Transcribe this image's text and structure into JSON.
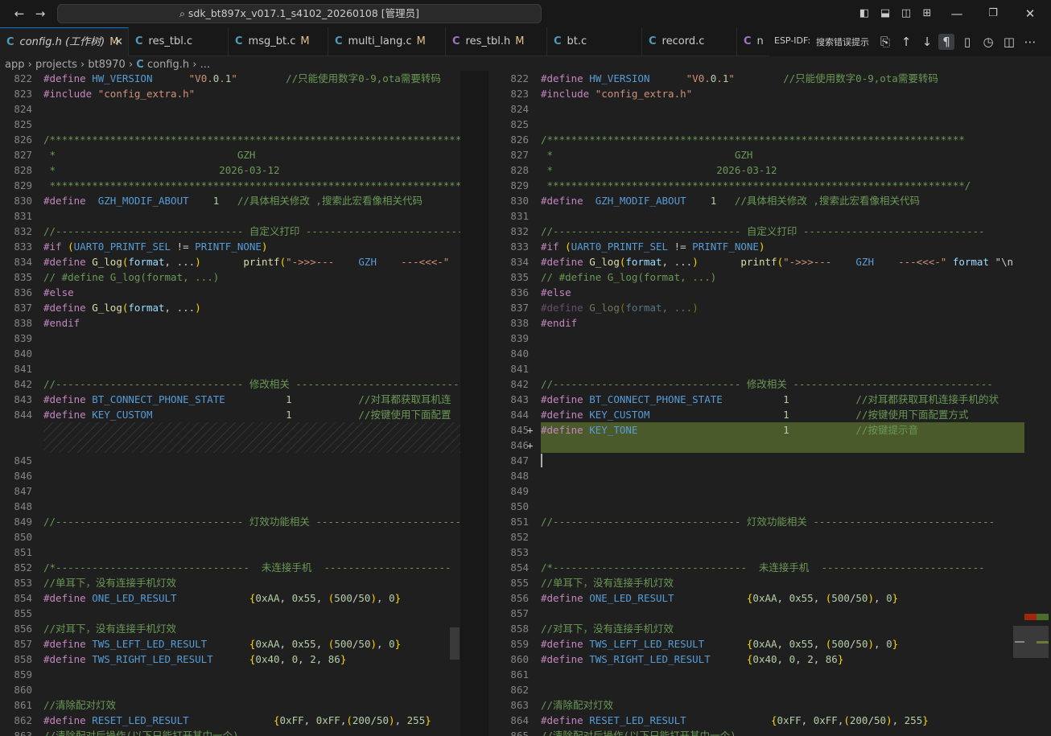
{
  "titlebar": {
    "title": "sdk_bt897x_v017.1_s4102_20260108 [管理员]",
    "back": "←",
    "forward": "→",
    "min": "—",
    "max": "❐",
    "close": "✕"
  },
  "tabs": [
    {
      "label": "config.h (工作树)",
      "mod": "M",
      "icon": "C",
      "active": true
    },
    {
      "label": "res_tbl.c",
      "mod": "",
      "icon": "C"
    },
    {
      "label": "msg_bt.c",
      "mod": "M",
      "icon": "C"
    },
    {
      "label": "multi_lang.c",
      "mod": "M",
      "icon": "C"
    },
    {
      "label": "res_tbl.h",
      "mod": "M",
      "icon": "C"
    },
    {
      "label": "bt.c",
      "mod": "",
      "icon": "C"
    },
    {
      "label": "record.c",
      "mod": "",
      "icon": "C"
    },
    {
      "label": "n",
      "mod": "",
      "icon": "C"
    }
  ],
  "tabtools": {
    "esp": "ESP-IDF:",
    "search": "搜索错误提示"
  },
  "breadcrumb": {
    "app": "app",
    "projects": "projects",
    "bt8970": "bt8970",
    "file": "config.h",
    "more": "..."
  },
  "left": {
    "lines": [
      {
        "n": "822",
        "t": "#define HW_VERSION      \"V0.0.1\"        //只能使用数字0-9,ota需要转码"
      },
      {
        "n": "823",
        "t": "#include \"config_extra.h\""
      },
      {
        "n": "824",
        "t": ""
      },
      {
        "n": "825",
        "t": ""
      },
      {
        "n": "826",
        "t": "/*********************************************************************"
      },
      {
        "n": "827",
        "t": " *                              GZH"
      },
      {
        "n": "828",
        "t": " *                           2026-03-12"
      },
      {
        "n": "829",
        "t": " *********************************************************************"
      },
      {
        "n": "830",
        "t": "#define  GZH_MODIF_ABOUT    1   //具体相关修改 ,搜索此宏看像相关代码"
      },
      {
        "n": "831",
        "t": ""
      },
      {
        "n": "832",
        "t": "//------------------------------- 自定义打印 --------------------------"
      },
      {
        "n": "833",
        "t": "#if (UART0_PRINTF_SEL != PRINTF_NONE)"
      },
      {
        "n": "834",
        "t": "#define G_log(format, ...)       printf(\"->>>---    GZH    ---<<<-\""
      },
      {
        "n": "835",
        "t": "// #define G_log(format, ...)"
      },
      {
        "n": "836",
        "t": "#else"
      },
      {
        "n": "837",
        "t": "#define G_log(format, ...)"
      },
      {
        "n": "838",
        "t": "#endif"
      },
      {
        "n": "839",
        "t": ""
      },
      {
        "n": "840",
        "t": ""
      },
      {
        "n": "841",
        "t": ""
      },
      {
        "n": "842",
        "t": "//------------------------------- 修改相关 ----------------------------"
      },
      {
        "n": "843",
        "t": "#define BT_CONNECT_PHONE_STATE          1           //对耳都获取耳机连"
      },
      {
        "n": "844",
        "t": "#define KEY_CUSTOM                      1           //按键使用下面配置"
      }
    ],
    "lines2": [
      {
        "n": "845",
        "t": ""
      },
      {
        "n": "846",
        "t": ""
      },
      {
        "n": "847",
        "t": ""
      },
      {
        "n": "848",
        "t": ""
      },
      {
        "n": "849",
        "t": "//------------------------------- 灯效功能相关 ------------------------"
      },
      {
        "n": "850",
        "t": ""
      },
      {
        "n": "851",
        "t": ""
      },
      {
        "n": "852",
        "t": "/*--------------------------------  未连接手机  ---------------------"
      },
      {
        "n": "853",
        "t": "//单耳下，没有连接手机灯效"
      },
      {
        "n": "854",
        "t": "#define ONE_LED_RESULT            {0xAA, 0x55, (500/50), 0}"
      },
      {
        "n": "855",
        "t": ""
      },
      {
        "n": "856",
        "t": "//对耳下，没有连接手机灯效"
      },
      {
        "n": "857",
        "t": "#define TWS_LEFT_LED_RESULT       {0xAA, 0x55, (500/50), 0}"
      },
      {
        "n": "858",
        "t": "#define TWS_RIGHT_LED_RESULT      {0x40, 0, 2, 86}"
      },
      {
        "n": "859",
        "t": ""
      },
      {
        "n": "860",
        "t": ""
      },
      {
        "n": "861",
        "t": "//清除配对灯效"
      },
      {
        "n": "862",
        "t": "#define RESET_LED_RESULT              {0xFF, 0xFF,(200/50), 255}"
      },
      {
        "n": "863",
        "t": "//清除配对后操作(以下只能打开其中一个)"
      }
    ]
  },
  "right": {
    "lines": [
      {
        "n": "822",
        "t": "#define HW_VERSION      \"V0.0.1\"        //只能使用数字0-9,ota需要转码"
      },
      {
        "n": "823",
        "t": "#include \"config_extra.h\""
      },
      {
        "n": "824",
        "t": ""
      },
      {
        "n": "825",
        "t": ""
      },
      {
        "n": "826",
        "t": "/*********************************************************************"
      },
      {
        "n": "827",
        "t": " *                              GZH"
      },
      {
        "n": "828",
        "t": " *                           2026-03-12"
      },
      {
        "n": "829",
        "t": " *********************************************************************/"
      },
      {
        "n": "830",
        "t": "#define  GZH_MODIF_ABOUT    1   //具体相关修改 ,搜索此宏看像相关代码"
      },
      {
        "n": "831",
        "t": ""
      },
      {
        "n": "832",
        "t": "//------------------------------- 自定义打印 ------------------------------"
      },
      {
        "n": "833",
        "t": "#if (UART0_PRINTF_SEL != PRINTF_NONE)"
      },
      {
        "n": "834",
        "t": "#define G_log(format, ...)       printf(\"->>>---    GZH    ---<<<-\" format \"\\n"
      },
      {
        "n": "835",
        "t": "// #define G_log(format, ...)"
      },
      {
        "n": "836",
        "t": "#else"
      },
      {
        "n": "837",
        "t": "#define G_log(format, ...)"
      },
      {
        "n": "838",
        "t": "#endif"
      },
      {
        "n": "839",
        "t": ""
      },
      {
        "n": "840",
        "t": ""
      },
      {
        "n": "841",
        "t": ""
      },
      {
        "n": "842",
        "t": "//------------------------------- 修改相关 ---------------------------------"
      },
      {
        "n": "843",
        "t": "#define BT_CONNECT_PHONE_STATE          1           //对耳都获取耳机连接手机的状"
      },
      {
        "n": "844",
        "t": "#define KEY_CUSTOM                      1           //按键使用下面配置方式"
      },
      {
        "n": "845",
        "t": "#define KEY_TONE                        1           //按键提示音"
      },
      {
        "n": "846",
        "t": ""
      },
      {
        "n": "847",
        "t": ""
      },
      {
        "n": "848",
        "t": ""
      },
      {
        "n": "849",
        "t": ""
      },
      {
        "n": "850",
        "t": ""
      },
      {
        "n": "851",
        "t": "//------------------------------- 灯效功能相关 ------------------------------"
      },
      {
        "n": "852",
        "t": ""
      },
      {
        "n": "853",
        "t": ""
      },
      {
        "n": "854",
        "t": "/*--------------------------------  未连接手机  ---------------------------"
      },
      {
        "n": "855",
        "t": "//单耳下，没有连接手机灯效"
      },
      {
        "n": "856",
        "t": "#define ONE_LED_RESULT            {0xAA, 0x55, (500/50), 0}"
      },
      {
        "n": "857",
        "t": ""
      },
      {
        "n": "858",
        "t": "//对耳下，没有连接手机灯效"
      },
      {
        "n": "859",
        "t": "#define TWS_LEFT_LED_RESULT       {0xAA, 0x55, (500/50), 0}"
      },
      {
        "n": "860",
        "t": "#define TWS_RIGHT_LED_RESULT      {0x40, 0, 2, 86}"
      },
      {
        "n": "861",
        "t": ""
      },
      {
        "n": "862",
        "t": ""
      },
      {
        "n": "863",
        "t": "//清除配对灯效"
      },
      {
        "n": "864",
        "t": "#define RESET_LED_RESULT              {0xFF, 0xFF,(200/50), 255}"
      },
      {
        "n": "865",
        "t": "//清除配对后操作(以下只能打开其中一个)"
      }
    ]
  },
  "colors": {
    "added": "#4b5a2a",
    "accent": "#0078d4",
    "bg": "#1f1f1f"
  }
}
